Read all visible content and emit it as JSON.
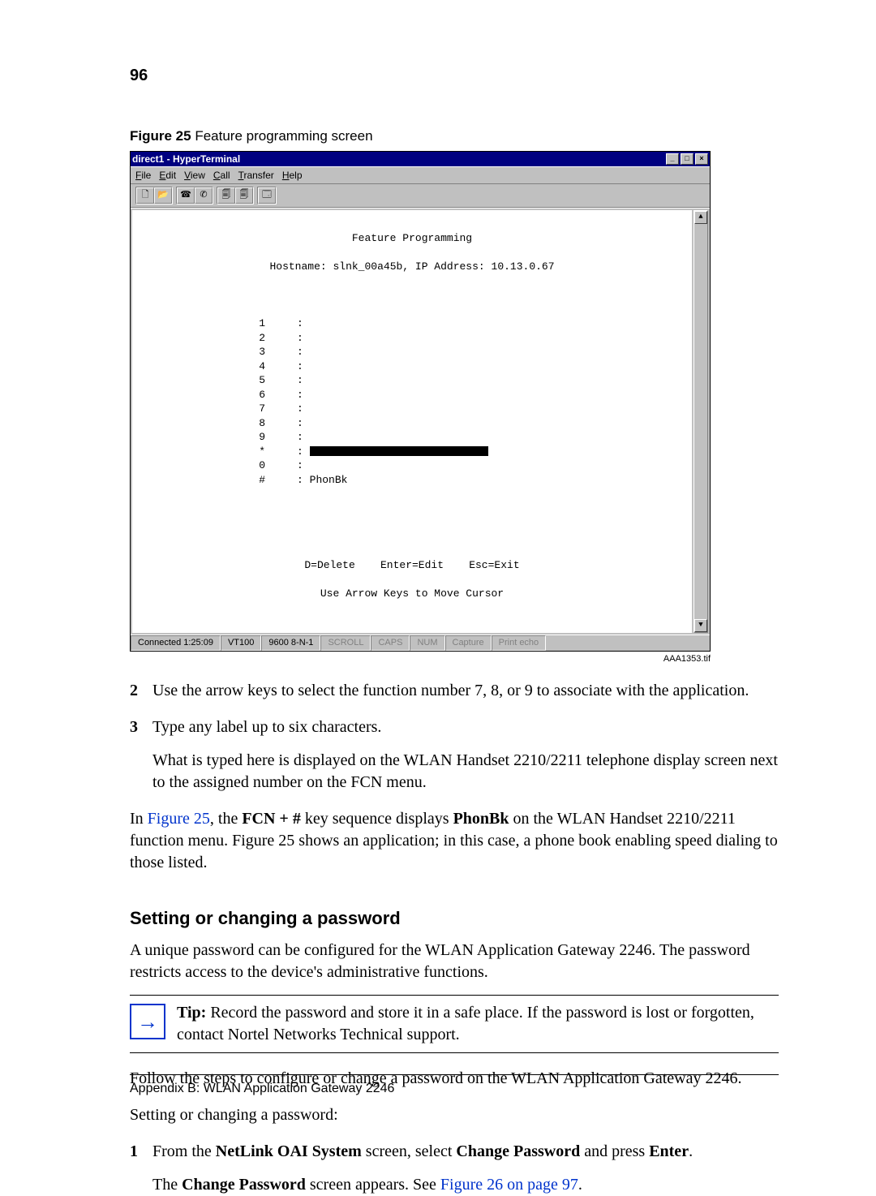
{
  "page_number": "96",
  "figure": {
    "label_bold": "Figure 25",
    "label_rest": "   Feature programming screen",
    "window_title": "direct1 - HyperTerminal",
    "menubar": {
      "file": "File",
      "edit": "Edit",
      "view": "View",
      "call": "Call",
      "transfer": "Transfer",
      "help": "Help"
    },
    "content": {
      "title": "Feature Programming",
      "hostline": "Hostname: slnk_00a45b, IP Address: 10.13.0.67",
      "rows": [
        {
          "key": "1",
          "val": ""
        },
        {
          "key": "2",
          "val": ""
        },
        {
          "key": "3",
          "val": ""
        },
        {
          "key": "4",
          "val": ""
        },
        {
          "key": "5",
          "val": ""
        },
        {
          "key": "6",
          "val": ""
        },
        {
          "key": "7",
          "val": ""
        },
        {
          "key": "8",
          "val": ""
        },
        {
          "key": "9",
          "val": ""
        },
        {
          "key": "*",
          "val": "[REDACTED]"
        },
        {
          "key": "0",
          "val": ""
        },
        {
          "key": "#",
          "val": "PhonBk"
        }
      ],
      "footer1": "D=Delete    Enter=Edit    Esc=Exit",
      "footer2": "Use Arrow Keys to Move Cursor"
    },
    "statusbar": {
      "connected": "Connected 1:25:09",
      "term": "VT100",
      "baud": "9600 8-N-1",
      "scroll": "SCROLL",
      "caps": "CAPS",
      "num": "NUM",
      "capture": "Capture",
      "echo": "Print echo"
    },
    "figure_id": "AAA1353.tif"
  },
  "steps_a": {
    "item2_num": "2",
    "item2_text": "Use the arrow keys to select the function number 7, 8, or 9 to associate with the application.",
    "item3_num": "3",
    "item3_text": "Type any label up to six characters.",
    "item3_follow": "What is typed here is displayed on the WLAN Handset 2210/2211 telephone display screen next to the assigned number on the FCN menu."
  },
  "para_fig25": {
    "prefix": "In ",
    "link": "Figure 25",
    "rest1": ", the ",
    "bold1": "FCN + #",
    "rest2": " key sequence displays ",
    "bold2": "PhonBk",
    "rest3": " on the WLAN Handset 2210/2211 function menu. Figure 25 shows an application; in this case, a phone book enabling speed dialing to those listed."
  },
  "section": {
    "heading": "Setting or changing a password",
    "p1": "A unique password can be configured for the WLAN Application Gateway 2246. The password restricts access to the device's administrative functions.",
    "tip_bold": "Tip:",
    "tip_text": " Record the password and store it in a safe place. If the password is lost or forgotten, contact Nortel Networks Technical support.",
    "p2": "Follow the steps to configure or change a password on the WLAN Application Gateway 2246.",
    "p3": "Setting or changing a password:",
    "step1_num": "1",
    "step1_pre": "From the ",
    "step1_b1": "NetLink OAI System",
    "step1_mid": " screen, select ",
    "step1_b2": "Change Password",
    "step1_mid2": " and press ",
    "step1_b3": "Enter",
    "step1_end": ".",
    "step1_follow_pre": "The ",
    "step1_follow_b": "Change Password",
    "step1_follow_mid": " screen appears. See ",
    "step1_follow_link": "Figure 26 on page 97",
    "step1_follow_end": "."
  },
  "footer": "Appendix B: WLAN Application Gateway 2246"
}
